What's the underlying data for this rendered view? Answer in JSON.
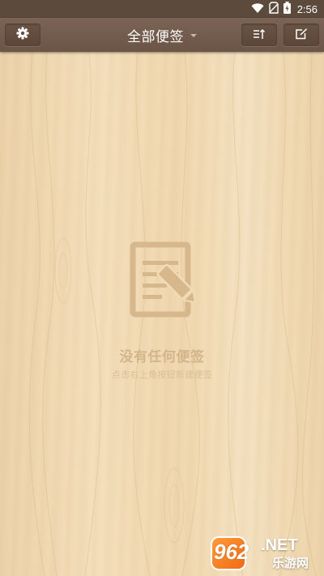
{
  "status_bar": {
    "time": "2:56",
    "icons": [
      "wifi-icon",
      "no-sim-icon",
      "battery-icon"
    ]
  },
  "toolbar": {
    "title": "全部便签",
    "left_icon": "gear-icon",
    "right_icons": [
      "sort-icon",
      "new-note-icon"
    ]
  },
  "empty_state": {
    "icon": "note-edit-icon",
    "title": "没有任何便签",
    "hint": "点击右上角按钮新建便签"
  },
  "watermark": {
    "number": "962",
    "suffix": ".NET",
    "site": "乐游网"
  },
  "colors": {
    "status_bar": "#5c4a3d",
    "toolbar": "#6f5949",
    "background": "#f1dbb6",
    "empty_text": "#d3b58a"
  }
}
